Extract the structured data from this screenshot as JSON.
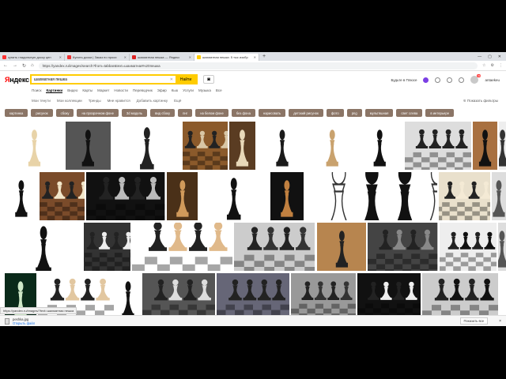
{
  "tabs": [
    {
      "label": "купить гладильную доску цен",
      "color": "#f33"
    },
    {
      "label": "Купить доски | Заказ по проси",
      "color": "#e33"
    },
    {
      "label": "шахматная пешка — Яндекс",
      "color": "#d22"
    },
    {
      "label": "шахматная пешка: 5 тыс изобр",
      "color": "#fc0",
      "active": true
    }
  ],
  "address": {
    "url": "https://yandex.ru/images/search?from=tabbar&text=шахматная%20пешка"
  },
  "header": {
    "logo_red": "Я",
    "logo_rest": "ндекс",
    "search_value": "шахматная пешка",
    "find_label": "Найти",
    "plus_label": "Будьте в Плюсе",
    "user": "antaekeu",
    "badge": "99"
  },
  "services": [
    "Поиск",
    "Картинки",
    "Видео",
    "Карты",
    "Маркет",
    "Новости",
    "Переводчик",
    "Эфир",
    "Кью",
    "Услуги",
    "Музыка",
    "Все"
  ],
  "active_service": 1,
  "subnav": [
    "Мои тянути",
    "Мои коллекции",
    "Тренды",
    "Мне нравится",
    "Добавить картинку",
    "Ещё"
  ],
  "filters_label": "Показать фильтры",
  "chips": [
    "картинка",
    "рисунок",
    "сбоку",
    "на прозрачном фоне",
    "3d модель",
    "вид сбоку",
    "пнг",
    "на белом фоне",
    "без фона",
    "нарисовать",
    "детский рисунок",
    "фото",
    "png",
    "мультяшная",
    "свет слева",
    "в интерьере"
  ],
  "status_url": "https://yandex.ru/images/?text=шахматная пешка",
  "download": {
    "file": "peshka.jpg",
    "open": "Открыть файл",
    "show_all": "Показать все",
    "close": "×"
  },
  "icons": {
    "back": "arrow-left",
    "forward": "arrow-right",
    "reload": "reload",
    "camera": "camera",
    "clear": "close"
  }
}
